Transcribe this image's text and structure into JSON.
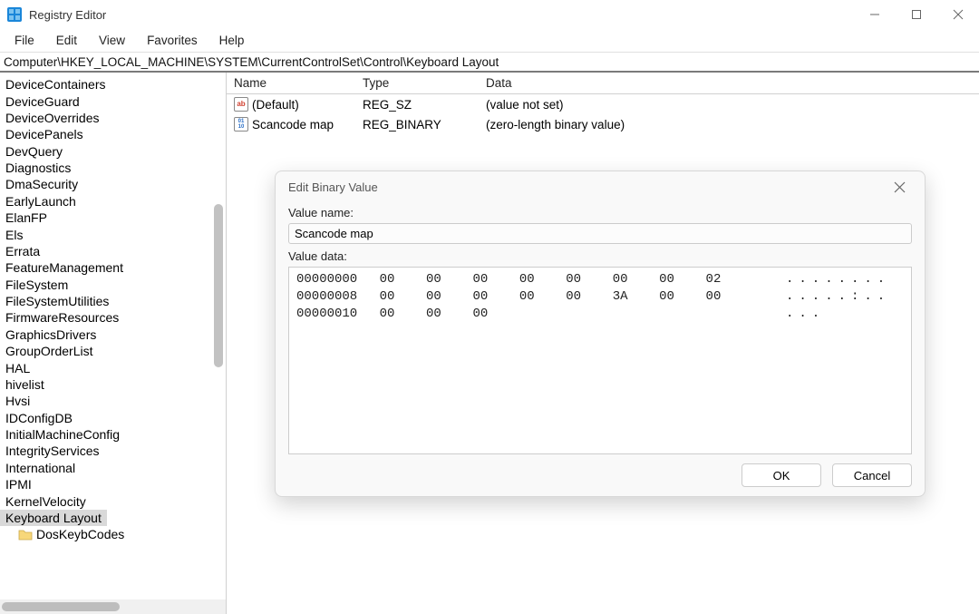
{
  "window": {
    "title": "Registry Editor"
  },
  "menubar": [
    "File",
    "Edit",
    "View",
    "Favorites",
    "Help"
  ],
  "pathbar": "Computer\\HKEY_LOCAL_MACHINE\\SYSTEM\\CurrentControlSet\\Control\\Keyboard Layout",
  "tree": {
    "items": [
      {
        "label": "DeviceContainers"
      },
      {
        "label": "DeviceGuard"
      },
      {
        "label": "DeviceOverrides"
      },
      {
        "label": "DevicePanels"
      },
      {
        "label": "DevQuery"
      },
      {
        "label": "Diagnostics"
      },
      {
        "label": "DmaSecurity"
      },
      {
        "label": "EarlyLaunch"
      },
      {
        "label": "ElanFP"
      },
      {
        "label": "Els"
      },
      {
        "label": "Errata"
      },
      {
        "label": "FeatureManagement"
      },
      {
        "label": "FileSystem"
      },
      {
        "label": "FileSystemUtilities"
      },
      {
        "label": "FirmwareResources"
      },
      {
        "label": "GraphicsDrivers"
      },
      {
        "label": "GroupOrderList"
      },
      {
        "label": "HAL"
      },
      {
        "label": "hivelist"
      },
      {
        "label": "Hvsi"
      },
      {
        "label": "IDConfigDB"
      },
      {
        "label": "InitialMachineConfig"
      },
      {
        "label": "IntegrityServices"
      },
      {
        "label": "International"
      },
      {
        "label": "IPMI"
      },
      {
        "label": "KernelVelocity"
      },
      {
        "label": "Keyboard Layout",
        "selected": true
      },
      {
        "label": "DosKeybCodes",
        "child": true
      }
    ]
  },
  "list": {
    "headers": {
      "name": "Name",
      "type": "Type",
      "data": "Data"
    },
    "rows": [
      {
        "icon": "str",
        "name": "(Default)",
        "type": "REG_SZ",
        "data": "(value not set)"
      },
      {
        "icon": "bin",
        "name": "Scancode map",
        "type": "REG_BINARY",
        "data": "(zero-length binary value)"
      }
    ]
  },
  "dialog": {
    "title": "Edit Binary Value",
    "valuename_label": "Value name:",
    "valuename": "Scancode map",
    "valuedata_label": "Value data:",
    "hexlines": [
      {
        "addr": "00000000",
        "bytes": [
          "00",
          "00",
          "00",
          "00",
          "00",
          "00",
          "00",
          "02"
        ],
        "ascii": "........"
      },
      {
        "addr": "00000008",
        "bytes": [
          "00",
          "00",
          "00",
          "00",
          "00",
          "3A",
          "00",
          "00"
        ],
        "ascii": ".....:.."
      },
      {
        "addr": "00000010",
        "bytes": [
          "00",
          "00",
          "00"
        ],
        "ascii": "..."
      }
    ],
    "ok": "OK",
    "cancel": "Cancel"
  }
}
